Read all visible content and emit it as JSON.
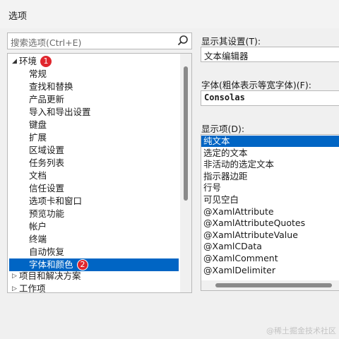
{
  "window": {
    "title": "选项"
  },
  "search": {
    "placeholder": "搜索选项(Ctrl+E)"
  },
  "tree": {
    "root_label": "环境",
    "root_badge": "1",
    "children": [
      "常规",
      "查找和替换",
      "产品更新",
      "导入和导出设置",
      "键盘",
      "扩展",
      "区域设置",
      "任务列表",
      "文档",
      "信任设置",
      "选项卡和窗口",
      "预览功能",
      "帐户",
      "终端",
      "自动恢复",
      "字体和颜色"
    ],
    "selected_badge": "2",
    "siblings": [
      "项目和解决方案",
      "工作项"
    ]
  },
  "settings": {
    "show_settings_label": "显示其设置(T):",
    "show_settings_value": "文本编辑器",
    "font_label": "字体(粗体表示等宽字体)(F):",
    "font_value": "Consolas",
    "display_items_label": "显示项(D):",
    "display_items": [
      "纯文本",
      "选定的文本",
      "非活动的选定文本",
      "指示器边距",
      "行号",
      "可见空白",
      "@XamlAttribute",
      "@XamlAttributeQuotes",
      "@XamlAttributeValue",
      "@XamlCData",
      "@XamlComment",
      "@XamlDelimiter"
    ],
    "selected_item": "纯文本"
  },
  "watermark": "@稀土掘金技术社区",
  "colors": {
    "accent": "#0065c4",
    "badge": "#e0262d"
  }
}
